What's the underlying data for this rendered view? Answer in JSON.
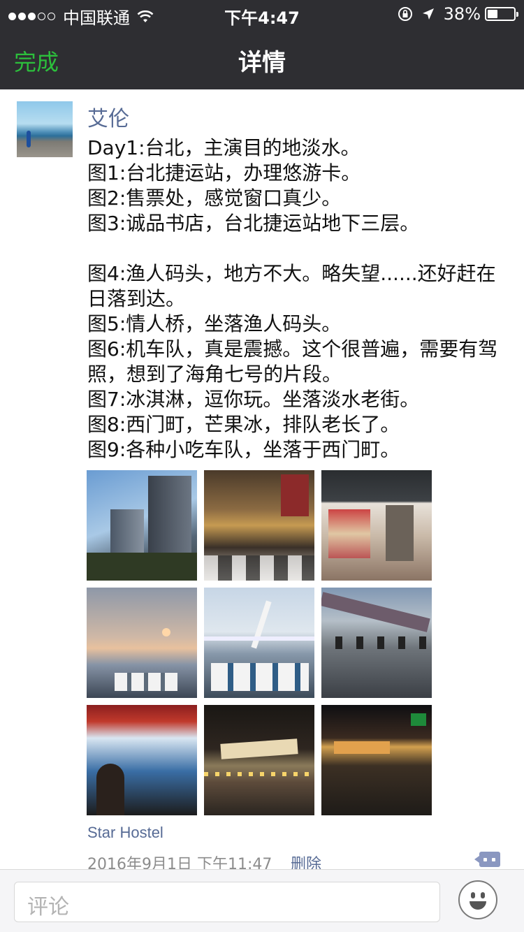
{
  "status_bar": {
    "signal_dots_filled": 3,
    "signal_dots_total": 5,
    "carrier": "中国联通",
    "time": "下午4:47",
    "battery_percent": "38%",
    "battery_level": 0.38
  },
  "nav": {
    "done_label": "完成",
    "title": "详情"
  },
  "post": {
    "author": "艾伦",
    "lines": [
      "Day1:台北，主演目的地淡水。",
      "图1:台北捷运站，办理悠游卡。",
      "图2:售票处，感觉窗口真少。",
      "图3:诚品书店，台北捷运站地下三层。",
      "",
      "图4:渔人码头，地方不大。略失望......还好赶在日落到达。",
      "图5:情人桥，坐落渔人码头。",
      "图6:机车队，真是震撼。这个很普遍，需要有驾照，想到了海角七号的片段。",
      "图7:冰淇淋，逗你玩。坐落淡水老街。",
      "图8:西门町，芒果冰，排队老长了。",
      "图9:各种小吃车队，坐落于西门町。"
    ],
    "location": "Star Hostel",
    "timestamp": "2016年9月1日 下午11:47",
    "delete_label": "删除"
  },
  "comment_bar": {
    "placeholder": "评论"
  },
  "colors": {
    "bar_bg": "#2e2e32",
    "done_green": "#2cbf3c",
    "link_blue": "#576b95"
  },
  "icons": [
    "wifi-icon",
    "rotation-lock-icon",
    "location-arrow-icon",
    "battery-icon",
    "comment-icon",
    "emoji-icon"
  ]
}
